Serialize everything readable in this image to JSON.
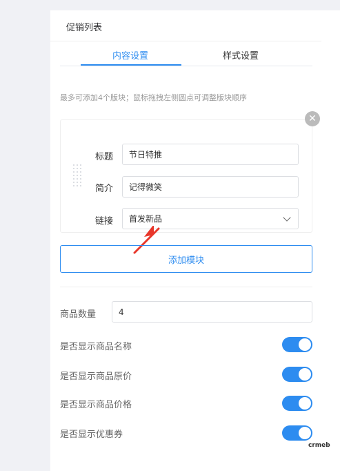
{
  "panel": {
    "title": "促销列表"
  },
  "tabs": [
    {
      "label": "内容设置",
      "active": true
    },
    {
      "label": "样式设置",
      "active": false
    }
  ],
  "hint": "最多可添加4个版块；鼠标拖拽左侧圆点可调整版块顺序",
  "block": {
    "remove_icon": "close-icon",
    "fields": [
      {
        "label": "标题",
        "value": "节日特推"
      },
      {
        "label": "简介",
        "value": "记得微笑"
      },
      {
        "label": "链接",
        "value": "首发新品"
      }
    ]
  },
  "add_button": "添加模块",
  "quantity": {
    "label": "商品数量",
    "value": "4"
  },
  "toggles": [
    {
      "label": "是否显示商品名称",
      "on": true
    },
    {
      "label": "是否显示商品原价",
      "on": true
    },
    {
      "label": "是否显示商品价格",
      "on": true
    },
    {
      "label": "是否显示优惠券",
      "on": true
    }
  ],
  "watermark": "crmeb",
  "colors": {
    "accent": "#2d8cf0",
    "arrow": "#e8362a"
  }
}
